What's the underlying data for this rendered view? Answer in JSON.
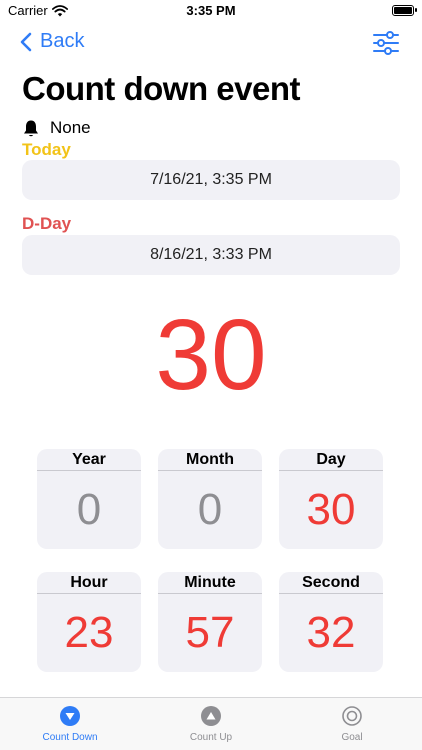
{
  "status": {
    "carrier": "Carrier",
    "time": "3:35 PM"
  },
  "nav": {
    "back_label": "Back"
  },
  "page": {
    "title": "Count down event",
    "alarm_label": "None"
  },
  "today": {
    "label": "Today",
    "value": "7/16/21, 3:35 PM"
  },
  "dday": {
    "label": "D-Day",
    "value": "8/16/21, 3:33 PM"
  },
  "countdown": {
    "big_value": "30",
    "cards": [
      {
        "label": "Year",
        "value": "0"
      },
      {
        "label": "Month",
        "value": "0"
      },
      {
        "label": "Day",
        "value": "30"
      },
      {
        "label": "Hour",
        "value": "23"
      },
      {
        "label": "Minute",
        "value": "57"
      },
      {
        "label": "Second",
        "value": "32"
      }
    ]
  },
  "tabs": [
    {
      "label": "Count Down"
    },
    {
      "label": "Count Up"
    },
    {
      "label": "Goal"
    }
  ],
  "colors": {
    "accent": "#2f7cf6",
    "today": "#f2c318",
    "dday": "#e05252",
    "count": "#ef3b36",
    "zero": "#8e8e92"
  },
  "icons": {
    "back": "chevron-left-icon",
    "settings": "sliders-icon",
    "alarm": "bell-icon",
    "tab_count_down": "circle-down-triangle-icon",
    "tab_count_up": "circle-up-triangle-icon",
    "tab_goal": "target-icon"
  }
}
